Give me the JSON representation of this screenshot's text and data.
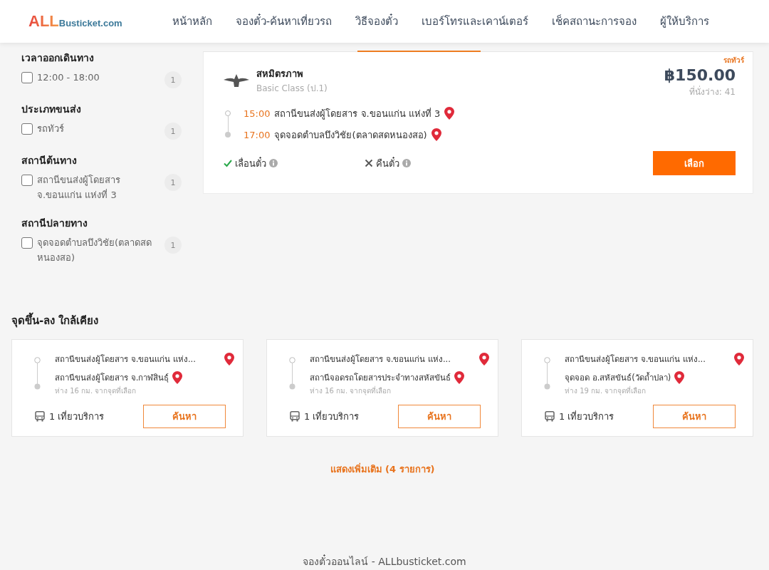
{
  "header": {
    "logo": {
      "accent": "ALL",
      "text": "Busticket.com"
    },
    "nav": [
      {
        "label": "หน้าหลัก"
      },
      {
        "label": "จองตั๋ว-ค้นหาเที่ยวรถ"
      },
      {
        "label": "วิธีจองตั๋ว"
      },
      {
        "label": "เบอร์โทรและเคาน์เตอร์"
      },
      {
        "label": "เช็คสถานะการจอง"
      },
      {
        "label": "ผู้ให้บริการ"
      }
    ]
  },
  "filters": [
    {
      "title": "เวลาออกเดินทาง",
      "options": [
        {
          "label": "12:00 - 18:00",
          "count": "1",
          "checked": false
        }
      ]
    },
    {
      "title": "ประเภทขนส่ง",
      "options": [
        {
          "label": "รถทัวร์",
          "count": "1",
          "checked": false
        }
      ]
    },
    {
      "title": "สถานีต้นทาง",
      "options": [
        {
          "label": "สถานีขนส่งผู้โดยสาร จ.ขอนแก่น แห่งที่ 3",
          "count": "1",
          "checked": false
        }
      ]
    },
    {
      "title": "สถานีปลายทาง",
      "options": [
        {
          "label": "จุดจอดตำบลบึงวิชัย(ตลาดสดหนองสอ)",
          "count": "1",
          "checked": false
        }
      ]
    }
  ],
  "trip": {
    "tag": "รถทัวร์",
    "operator": "สหมิตรภาพ",
    "bus_class": "Basic Class (ป.1)",
    "price": "฿150.00",
    "seats": "ที่นั่งว่าง: 41",
    "stops": [
      {
        "time": "15:00",
        "place": "สถานีขนส่งผู้โดยสาร จ.ขอนแก่น แห่งที่ 3"
      },
      {
        "time": "17:00",
        "place": "จุดจอดตำบลบึงวิชัย(ตลาดสดหนองสอ)"
      }
    ],
    "policies": [
      {
        "label": "เลื่อนตั๋ว",
        "allowed": true
      },
      {
        "label": "คืนตั๋ว",
        "allowed": false
      }
    ],
    "select_button": "เลือก"
  },
  "nearby": {
    "title": "จุดขึ้น-ลง ใกล้เคียง",
    "cards": [
      {
        "from": "สถานีขนส่งผู้โดยสาร จ.ขอนแก่น แห่ง...",
        "to": "สถานีขนส่งผู้โดยสาร จ.กาฬสินธุ์",
        "distance": "ห่าง 16 กม. จากจุดที่เลือก",
        "trips": "1 เที่ยวบริการ",
        "button": "ค้นหา"
      },
      {
        "from": "สถานีขนส่งผู้โดยสาร จ.ขอนแก่น แห่ง...",
        "to": "สถานีจอดรถโดยสารประจำทางสหัสขันธ์",
        "distance": "ห่าง 16 กม. จากจุดที่เลือก",
        "trips": "1 เที่ยวบริการ",
        "button": "ค้นหา"
      },
      {
        "from": "สถานีขนส่งผู้โดยสาร จ.ขอนแก่น แห่ง...",
        "to": "จุดจอด อ.สหัสขันธ์(วัดถ้ำปลา)",
        "distance": "ห่าง 19 กม. จากจุดที่เลือก",
        "trips": "1 เที่ยวบริการ",
        "button": "ค้นหา"
      }
    ],
    "show_more": "แสดงเพิ่มเติม (4 รายการ)"
  },
  "footer": "จองตั๋วออนไลน์ - ALLbusticket.com"
}
